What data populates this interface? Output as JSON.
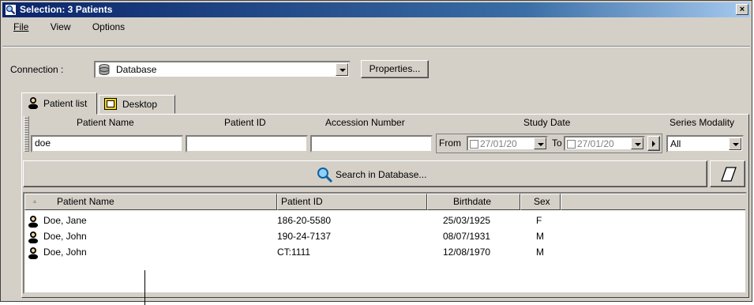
{
  "window": {
    "title": "Selection: 3 Patients",
    "close_label": "×"
  },
  "menu": [
    {
      "label": "File"
    },
    {
      "label": "View"
    },
    {
      "label": "Options"
    }
  ],
  "connection": {
    "label": "Connection :",
    "value": "Database",
    "properties_label": "Properties..."
  },
  "tabs": [
    {
      "label": "Patient list",
      "active": true
    },
    {
      "label": "Desktop",
      "active": false
    }
  ],
  "filters": {
    "headers": {
      "patient_name": "Patient Name",
      "patient_id": "Patient ID",
      "accession": "Accession Number",
      "study_date": "Study Date",
      "series_modality": "Series Modality"
    },
    "patient_name_value": "doe",
    "patient_id_value": "",
    "accession_value": "",
    "from_label": "From",
    "from_date": "27/01/20",
    "to_label": "To",
    "to_date": "27/01/20",
    "modality_value": "All"
  },
  "search_button": "Search in Database...",
  "table": {
    "columns": [
      "Patient Name",
      "Patient ID",
      "Birthdate",
      "Sex"
    ],
    "sort_indicator": "▲",
    "rows": [
      {
        "name": "Doe, Jane",
        "id": "186-20-5580",
        "birthdate": "25/03/1925",
        "sex": "F"
      },
      {
        "name": "Doe, John",
        "id": "190-24-7137",
        "birthdate": "08/07/1931",
        "sex": "M"
      },
      {
        "name": "Doe, John",
        "id": "CT:1111",
        "birthdate": "12/08/1970",
        "sex": "M"
      }
    ]
  },
  "colors": {
    "title_start": "#0a246a",
    "title_end": "#a6caf0",
    "face": "#d4d0c8"
  }
}
